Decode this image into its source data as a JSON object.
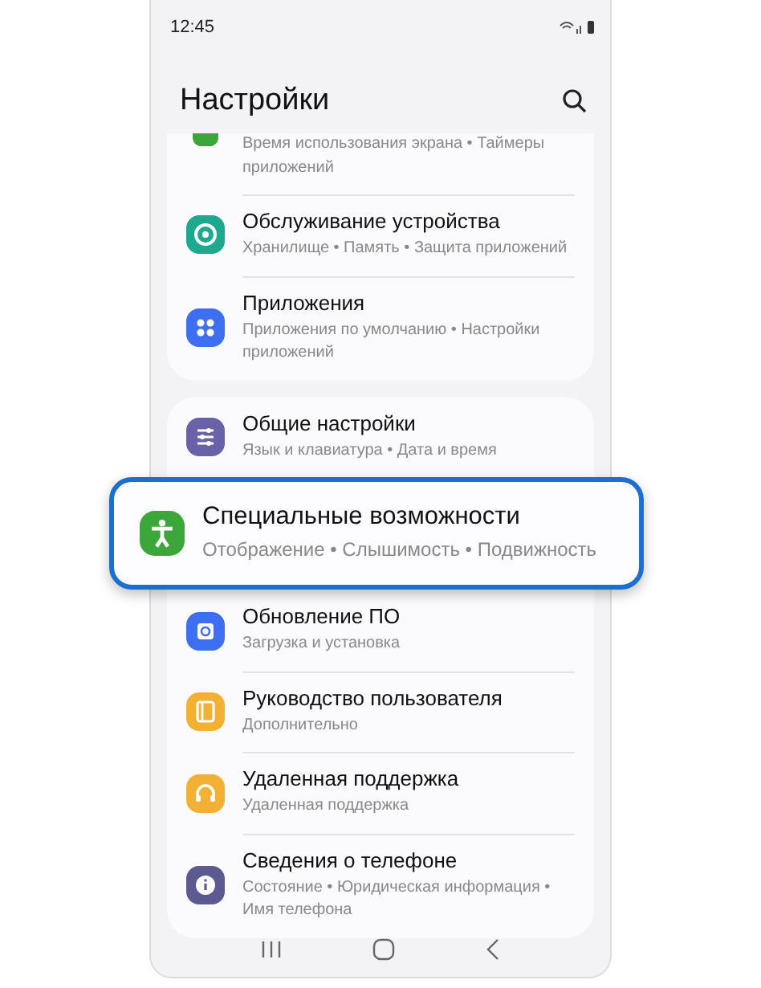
{
  "status_bar": {
    "time": "12:45"
  },
  "header": {
    "title": "Настройки"
  },
  "groups": [
    {
      "items": [
        {
          "kind": "screen-time",
          "subtitle": "Время использования экрана • Таймеры приложений",
          "color": "#3da63a",
          "cut": true,
          "highlighted": false
        },
        {
          "kind": "care",
          "title": "Обслуживание устройства",
          "subtitle": "Хранилище • Память • Защита приложений",
          "color": "#1ea98e",
          "cut": false,
          "highlighted": false
        },
        {
          "kind": "apps",
          "title": "Приложения",
          "subtitle": "Приложения по умолчанию • Настройки приложений",
          "color": "#3e6ff0",
          "cut": false,
          "highlighted": false
        }
      ]
    },
    {
      "items": [
        {
          "kind": "sliders",
          "title": "Общие настройки",
          "subtitle": "Язык и клавиатура • Дата и время",
          "color": "#6a62a8",
          "cut": false,
          "highlighted": false
        },
        {
          "kind": "accessibility",
          "title": "Специальные возможности",
          "subtitle": "Отображение • Слышимость • Подвижность",
          "color": "#3da63a",
          "cut": false,
          "highlighted": true
        },
        {
          "kind": "update",
          "title": "Обновление ПО",
          "subtitle": "Загрузка и установка",
          "color": "#3e6ff0",
          "cut": false,
          "highlighted": false
        },
        {
          "kind": "manual",
          "title": "Руководство пользователя",
          "subtitle": "Дополнительно",
          "color": "#f2b134",
          "cut": false,
          "highlighted": false
        },
        {
          "kind": "headset",
          "title": "Удаленная поддержка",
          "subtitle": "Удаленная поддержка",
          "color": "#f2b134",
          "cut": false,
          "highlighted": false
        },
        {
          "kind": "info",
          "title": "Сведения о телефоне",
          "subtitle": "Состояние • Юридическая информация • Имя телефона",
          "color": "#5d5a91",
          "cut": false,
          "highlighted": false
        }
      ]
    }
  ]
}
